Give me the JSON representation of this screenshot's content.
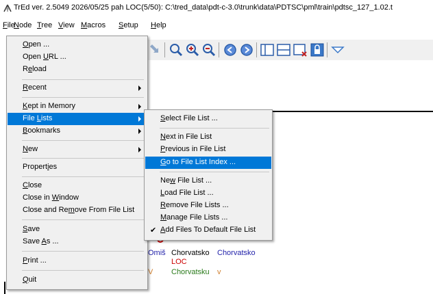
{
  "window": {
    "title": "TrEd ver. 2.5049    2026/05/25 pah LOC(5/50): C:\\tred_data\\pdt-c-3.0\\trunk\\data\\PDTSC\\pml\\train\\pdtsc_127_1.02.t"
  },
  "menubar": [
    {
      "key": "F",
      "rest": "ile"
    },
    {
      "key": "N",
      "rest": "ode"
    },
    {
      "key": "T",
      "rest": "ree"
    },
    {
      "key": "V",
      "rest": "iew"
    },
    {
      "key": "M",
      "rest": "acros"
    },
    {
      "key": "S",
      "rest": "etup"
    },
    {
      "key": "H",
      "rest": "elp"
    }
  ],
  "file_menu": {
    "items": [
      {
        "pre": "",
        "key": "O",
        "post": "pen ..."
      },
      {
        "pre": "Open ",
        "key": "U",
        "post": "RL ..."
      },
      {
        "pre": "R",
        "key": "e",
        "post": "load"
      },
      {
        "pre": "",
        "key": "R",
        "post": "ecent"
      },
      {
        "pre": "",
        "key": "K",
        "post": "ept in Memory"
      },
      {
        "pre": "File ",
        "key": "L",
        "post": "ists"
      },
      {
        "pre": "",
        "key": "B",
        "post": "ookmarks"
      },
      {
        "pre": "",
        "key": "N",
        "post": "ew"
      },
      {
        "pre": "Propert",
        "key": "i",
        "post": "es"
      },
      {
        "pre": "",
        "key": "C",
        "post": "lose"
      },
      {
        "pre": "Close in ",
        "key": "W",
        "post": "indow"
      },
      {
        "pre": "Close and Re",
        "key": "m",
        "post": "ove From File List"
      },
      {
        "pre": "",
        "key": "S",
        "post": "ave"
      },
      {
        "pre": "Save ",
        "key": "A",
        "post": "s ..."
      },
      {
        "pre": "",
        "key": "P",
        "post": "rint ..."
      },
      {
        "pre": "",
        "key": "Q",
        "post": "uit"
      }
    ]
  },
  "file_lists_submenu": {
    "items": [
      {
        "pre": "",
        "key": "S",
        "post": "elect File List ..."
      },
      {
        "pre": "",
        "key": "N",
        "post": "ext in File List"
      },
      {
        "pre": "",
        "key": "P",
        "post": "revious in File List"
      },
      {
        "pre": "",
        "key": "G",
        "post": "o to File List Index ..."
      },
      {
        "pre": "Ne",
        "key": "w",
        "post": " File List ..."
      },
      {
        "pre": "",
        "key": "L",
        "post": "oad File List ..."
      },
      {
        "pre": "",
        "key": "R",
        "post": "emove File Lists ..."
      },
      {
        "pre": "",
        "key": "M",
        "post": "anage File Lists ..."
      },
      {
        "pre": "",
        "key": "A",
        "post": "dd Files To Default File List"
      }
    ],
    "checkmark": "✔"
  },
  "tree": {
    "line1_a": "Omiš",
    "line1_b": "Chorvatsko",
    "line1_c": "Chorvatsko",
    "line2": "LOC",
    "line3_a": "V",
    "line3_b": "Chorvatsku",
    "line3_c": "v"
  },
  "colors": {
    "highlight": "#0078d7",
    "menu_bg": "#f0f0f0",
    "node_blue": "#2222aa",
    "node_red": "#cc0000",
    "node_green": "#2a7a1a",
    "node_orange": "#d08030"
  },
  "toolbar_icons": [
    "arrow-icon",
    "zoom-icon",
    "zoom-in-icon",
    "zoom-out-icon",
    "back-circle-icon",
    "forward-circle-icon",
    "window-icon",
    "split-window-icon",
    "close-window-icon",
    "lock-icon",
    "dropdown-triangle-icon"
  ]
}
